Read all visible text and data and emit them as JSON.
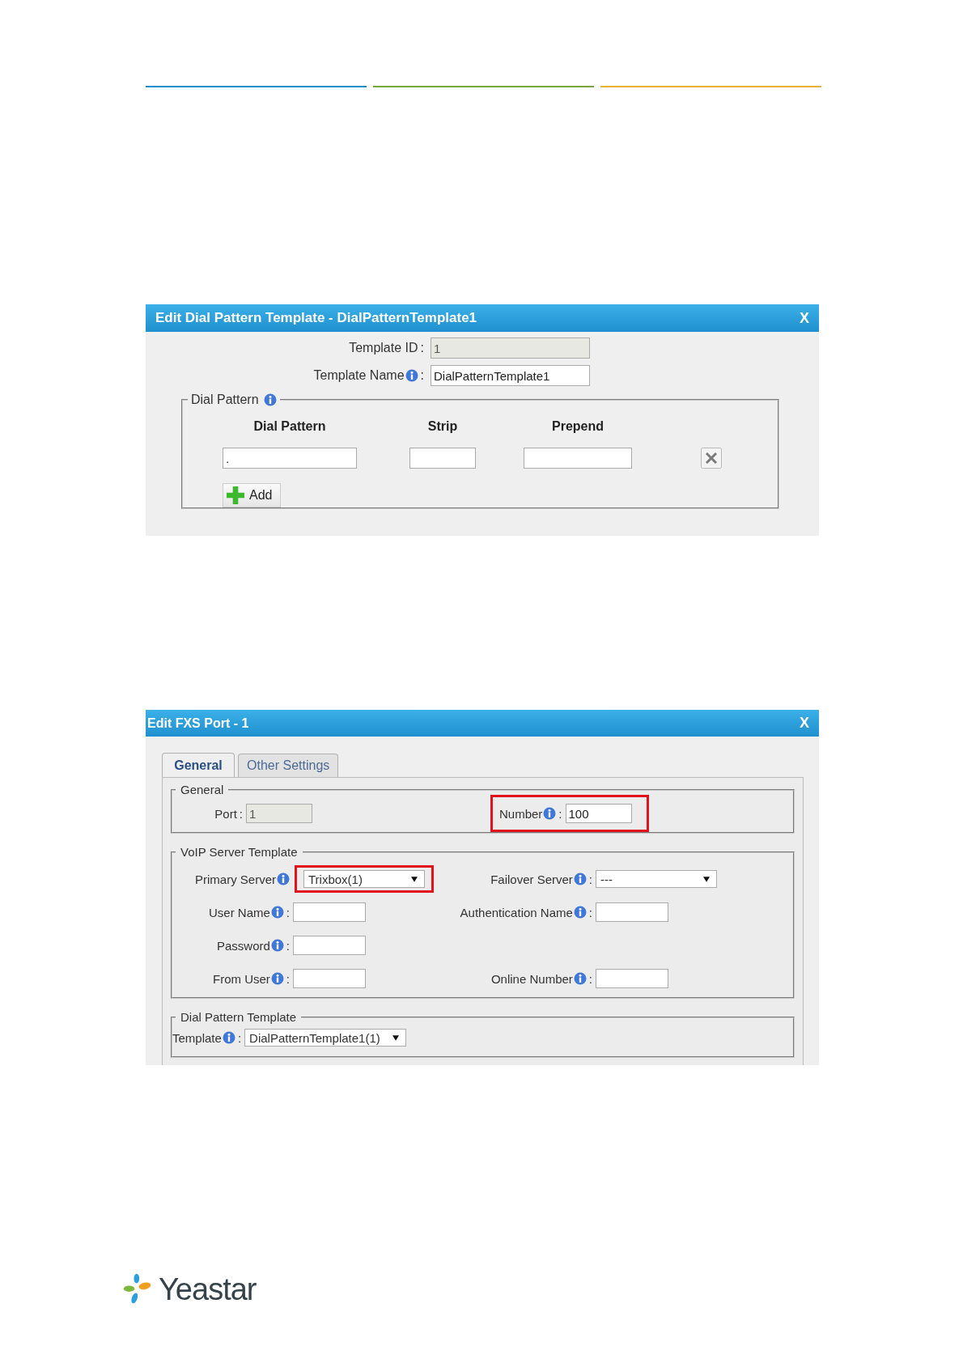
{
  "header_rules": [
    {
      "color": "#1b8ccc"
    },
    {
      "color": "#7ba53b"
    },
    {
      "color": "#e9b236"
    }
  ],
  "dial_dialog": {
    "title": "Edit Dial Pattern Template - DialPatternTemplate1",
    "close": "X",
    "fields": [
      {
        "label": "Template ID",
        "info": false,
        "suffix": ":",
        "value": "1",
        "disabled": true
      },
      {
        "label": "Template Name",
        "info": true,
        "suffix": ":",
        "value": "DialPatternTemplate1",
        "disabled": false
      }
    ],
    "group": {
      "legend": "Dial Pattern",
      "info": true,
      "columns": [
        "Dial Pattern",
        "Strip",
        "Prepend"
      ],
      "rows": [
        {
          "dial_pattern": "."
        }
      ],
      "add_button": "Add"
    }
  },
  "fxs_dialog": {
    "title": "Edit FXS Port - 1",
    "close": "X",
    "tabs": [
      {
        "label": "General",
        "selected": true
      },
      {
        "label": "Other Settings",
        "selected": false
      }
    ],
    "sections": [
      {
        "kind": "general",
        "legend": "General",
        "rows": [
          [
            {
              "label": "Port",
              "info": false,
              "suffix": ":",
              "kind": "text",
              "value": "1",
              "disabled": true
            },
            {
              "label": "Number",
              "info": true,
              "suffix": ":",
              "kind": "text",
              "value": "100",
              "disabled": false,
              "highlighted": true
            }
          ]
        ]
      },
      {
        "kind": "voip",
        "legend": "VoIP Server Template",
        "rows": [
          [
            {
              "label": "Primary Server",
              "info": true,
              "kind": "select",
              "value": "Trixbox(1)",
              "highlighted": true
            },
            {
              "label": "Failover Server",
              "info": true,
              "suffix": ":",
              "kind": "select",
              "value": "---"
            }
          ],
          [
            {
              "label": "User Name",
              "info": true,
              "suffix": ":",
              "kind": "text",
              "disabled": false
            },
            {
              "label": "Authentication Name",
              "info": true,
              "suffix": ":",
              "kind": "text",
              "disabled": false
            }
          ],
          [
            {
              "label": "Password",
              "info": true,
              "suffix": ":",
              "kind": "text",
              "disabled": false
            }
          ],
          [
            {
              "label": "From User",
              "info": true,
              "suffix": ":",
              "kind": "text",
              "disabled": false
            },
            {
              "label": "Online Number",
              "info": true,
              "suffix": ":",
              "kind": "text",
              "disabled": false
            }
          ]
        ]
      },
      {
        "kind": "template",
        "legend": "Dial Pattern Template",
        "rows": [
          [
            {
              "label": "Template",
              "info": true,
              "suffix": ":",
              "kind": "select",
              "value": "DialPatternTemplate1(1)"
            }
          ]
        ]
      }
    ]
  },
  "logo": {
    "text": "Yeastar"
  }
}
